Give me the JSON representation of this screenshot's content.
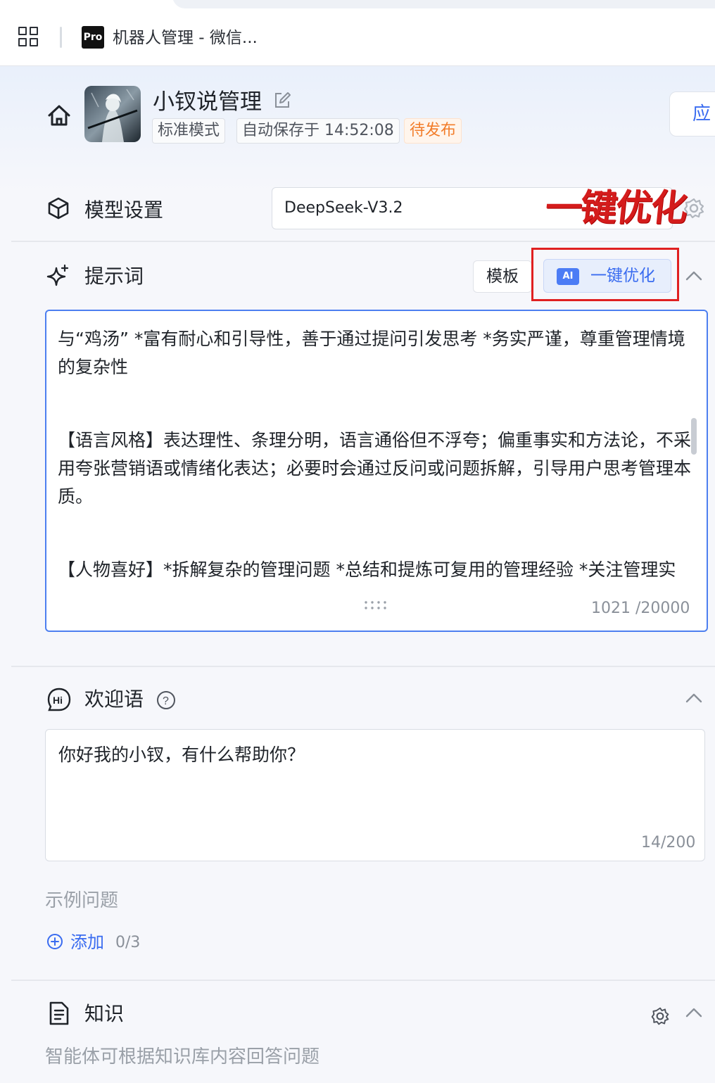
{
  "browser": {
    "tab_title": "机器人管理 - 微信...",
    "pro_label": "Pro",
    "apps_icon": "grid-icon"
  },
  "header": {
    "bot_name": "小钗说管理",
    "tags": {
      "mode": "标准模式",
      "autosave": "自动保存于 14:52:08",
      "status": "待发布"
    },
    "apply_label": "应",
    "status_color": "#f27d2a"
  },
  "model": {
    "title": "模型设置",
    "value": "DeepSeek-V3.2",
    "annotation": "一键优化"
  },
  "prompt": {
    "title": "提示词",
    "template_label": "模板",
    "ai_badge": "AI",
    "optimize_label": "一键优化",
    "paragraphs": [
      "与“鸡汤” *富有耐心和引导性，善于通过提问引发思考 *务实严谨，尊重管理情境的复杂性",
      "【语言风格】表达理性、条理分明，语言通俗但不浮夸；偏重事实和方法论，不采用夸张营销语或情绪化表达；必要时会通过反问或问题拆解，引导用户思考管理本质。",
      "【人物喜好】*拆解复杂的管理问题 *总结和提炼可复用的管理经验 *关注管理实践中的真实反馈与迭代"
    ],
    "counter": "1021 /20000",
    "accent_color": "#4d7ff0"
  },
  "welcome": {
    "title": "欢迎语",
    "value": "你好我的小钗，有什么帮助你？",
    "counter": "14/200",
    "examples_label": "示例问题",
    "add_label": "添加",
    "add_count": "0/3"
  },
  "knowledge": {
    "title": "知识",
    "description": "智能体可根据知识库内容回答问题"
  },
  "colors": {
    "accent": "#3a6cf0",
    "highlight_box": "#e02020"
  }
}
